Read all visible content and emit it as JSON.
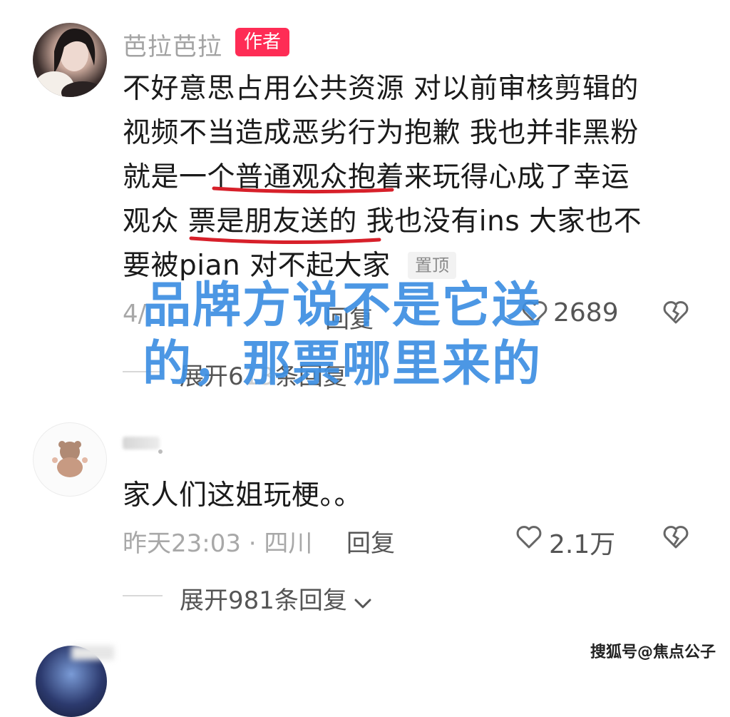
{
  "comments": [
    {
      "username": "芭拉芭拉",
      "badge": "作者",
      "lines": [
        "不好意思占用公共资源 对以前审核剪辑的",
        "视频不当造成恶劣行为抱歉 我也并非黑粉",
        "就是一个普通观众抱着来玩得心成了幸运",
        "观众 票是朋友送的 我也没有ins 大家也不",
        "要被pian 对不起大家"
      ],
      "pin_label": "置顶",
      "meta": "4/",
      "reply_label": "回复",
      "likes": "2689",
      "expand_text": "展开6",
      "expand_text_tail": "条回复"
    },
    {
      "text": "家人们这姐玩梗。。",
      "meta": "昨天23:03 · 四川",
      "reply_label": "回复",
      "likes": "2.1万",
      "expand_text": "展开981条回复"
    }
  ],
  "overlay": {
    "line1": "品牌方说不是它送",
    "line2": "的，那票哪里来的",
    "color": "#3d8fe2"
  },
  "accent_color": "#fe2c55",
  "watermark": "搜狐号@焦点公子",
  "icons": [
    "heart-icon",
    "dislike-heart-icon",
    "chevron-down-icon"
  ]
}
